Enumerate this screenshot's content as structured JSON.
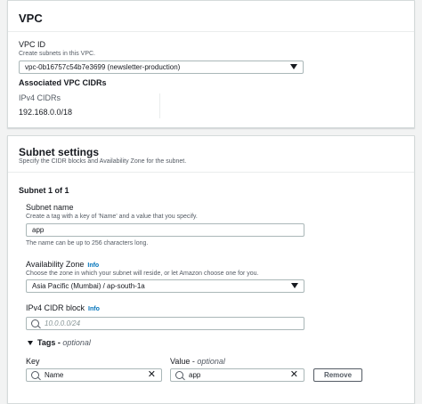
{
  "vpc_panel": {
    "title": "VPC",
    "vpc_id_label": "VPC ID",
    "vpc_id_desc": "Create subnets in this VPC.",
    "vpc_id_value": "vpc-0b16757c54b7e3699 (newsletter-production)",
    "assoc_title": "Associated VPC CIDRs",
    "ipv4_label": "IPv4 CIDRs",
    "ipv4_value": "192.168.0.0/18"
  },
  "subnet_panel": {
    "title": "Subnet settings",
    "desc": "Specify the CIDR blocks and Availability Zone for the subnet.",
    "subnet_heading": "Subnet 1 of 1",
    "name_label": "Subnet name",
    "name_desc": "Create a tag with a key of 'Name' and a value that you specify.",
    "name_value": "app",
    "name_hint": "The name can be up to 256 characters long.",
    "az_label": "Availability Zone",
    "az_info": "Info",
    "az_desc": "Choose the zone in which your subnet will reside, or let Amazon choose one for you.",
    "az_value": "Asia Pacific (Mumbai) / ap-south-1a",
    "cidr_label": "IPv4 CIDR block",
    "cidr_info": "Info",
    "cidr_placeholder": "10.0.0.0/24",
    "tags_label": "Tags - ",
    "tags_optional": "optional",
    "key_label": "Key",
    "value_label": "Value - ",
    "value_optional": "optional",
    "key_value": "Name",
    "value_value": "app",
    "remove_label": "Remove"
  },
  "colors": {
    "accent": "#0073bb",
    "background": "#f2f3f3"
  }
}
